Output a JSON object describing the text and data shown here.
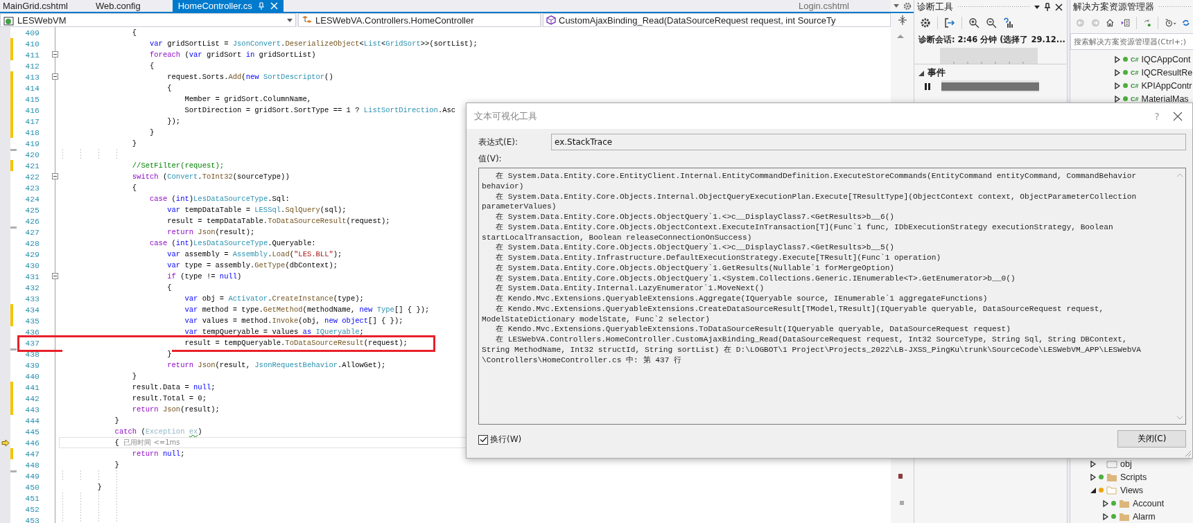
{
  "tabs": [
    {
      "label": "MainGrid.cshtml",
      "selected": false
    },
    {
      "label": "Web.config",
      "selected": false
    },
    {
      "label": "HomeController.cs",
      "selected": true
    },
    {
      "label": "Login.cshtml",
      "selected": false
    }
  ],
  "nav_bar": {
    "project": "LESWebVM",
    "class": "LESWebVA.Controllers.HomeController",
    "member": "CustomAjaxBinding_Read(DataSourceRequest request, int SourceTy"
  },
  "code_lines": [
    {
      "number": "409",
      "changed": false,
      "saved": false,
      "fold": false,
      "highlighted": false,
      "current": false,
      "tokens": [
        {
          "kind": "plain",
          "text": "                {"
        }
      ]
    },
    {
      "number": "410",
      "changed": true,
      "saved": false,
      "fold": false,
      "highlighted": false,
      "current": false,
      "tokens": [
        {
          "kind": "kw",
          "text": "                    var"
        },
        {
          "kind": "plain",
          "text": " gridSortList = "
        },
        {
          "kind": "type",
          "text": "JsonConvert"
        },
        {
          "kind": "plain",
          "text": "."
        },
        {
          "kind": "method",
          "text": "DeserializeObject"
        },
        {
          "kind": "plain",
          "text": "<"
        },
        {
          "kind": "type",
          "text": "List"
        },
        {
          "kind": "plain",
          "text": "<"
        },
        {
          "kind": "type",
          "text": "GridSort"
        },
        {
          "kind": "plain",
          "text": ">>(sortList);"
        }
      ]
    },
    {
      "number": "411",
      "changed": true,
      "saved": false,
      "fold": true,
      "highlighted": false,
      "current": false,
      "tokens": [
        {
          "kind": "ctrl",
          "text": "                    foreach"
        },
        {
          "kind": "plain",
          "text": " ("
        },
        {
          "kind": "kw",
          "text": "var"
        },
        {
          "kind": "plain",
          "text": " gridSort "
        },
        {
          "kind": "kw",
          "text": "in"
        },
        {
          "kind": "plain",
          "text": " gridSortList)"
        }
      ]
    },
    {
      "number": "412",
      "changed": false,
      "saved": false,
      "fold": false,
      "highlighted": false,
      "current": false,
      "tokens": [
        {
          "kind": "plain",
          "text": "                    {"
        }
      ]
    },
    {
      "number": "413",
      "changed": true,
      "saved": false,
      "fold": true,
      "highlighted": false,
      "current": false,
      "tokens": [
        {
          "kind": "plain",
          "text": "                        request.Sorts."
        },
        {
          "kind": "method",
          "text": "Add"
        },
        {
          "kind": "plain",
          "text": "("
        },
        {
          "kind": "kw",
          "text": "new "
        },
        {
          "kind": "type",
          "text": "SortDescriptor"
        },
        {
          "kind": "plain",
          "text": "()"
        }
      ]
    },
    {
      "number": "414",
      "changed": true,
      "saved": false,
      "fold": false,
      "highlighted": false,
      "current": false,
      "tokens": [
        {
          "kind": "plain",
          "text": "                        {"
        }
      ]
    },
    {
      "number": "415",
      "changed": true,
      "saved": false,
      "fold": false,
      "highlighted": false,
      "current": false,
      "tokens": [
        {
          "kind": "plain",
          "text": "                            Member = gridSort.ColumnName,"
        }
      ]
    },
    {
      "number": "416",
      "changed": true,
      "saved": false,
      "fold": false,
      "highlighted": false,
      "current": false,
      "tokens": [
        {
          "kind": "plain",
          "text": "                            SortDirection = gridSort.SortType == 1 ? "
        },
        {
          "kind": "type",
          "text": "ListSortDirection"
        },
        {
          "kind": "plain",
          "text": ".Asc"
        }
      ]
    },
    {
      "number": "417",
      "changed": true,
      "saved": false,
      "fold": false,
      "highlighted": false,
      "current": false,
      "tokens": [
        {
          "kind": "plain",
          "text": "                        });"
        }
      ]
    },
    {
      "number": "418",
      "changed": true,
      "saved": false,
      "fold": false,
      "highlighted": false,
      "current": false,
      "tokens": [
        {
          "kind": "plain",
          "text": "                    }"
        }
      ]
    },
    {
      "number": "419",
      "changed": false,
      "saved": false,
      "fold": false,
      "highlighted": false,
      "current": false,
      "tokens": [
        {
          "kind": "plain",
          "text": "                }"
        }
      ]
    },
    {
      "number": "420",
      "changed": false,
      "saved": true,
      "fold": false,
      "highlighted": false,
      "current": false
    },
    {
      "number": "421",
      "changed": true,
      "saved": false,
      "fold": false,
      "highlighted": false,
      "current": false,
      "tokens": [
        {
          "kind": "comment",
          "text": "                //SetFilter(request);"
        }
      ]
    },
    {
      "number": "422",
      "changed": false,
      "saved": false,
      "fold": true,
      "highlighted": false,
      "current": false,
      "tokens": [
        {
          "kind": "ctrl",
          "text": "                switch"
        },
        {
          "kind": "plain",
          "text": " ("
        },
        {
          "kind": "type",
          "text": "Convert"
        },
        {
          "kind": "plain",
          "text": "."
        },
        {
          "kind": "method",
          "text": "ToInt32"
        },
        {
          "kind": "plain",
          "text": "(sourceType))"
        }
      ]
    },
    {
      "number": "423",
      "changed": false,
      "saved": false,
      "fold": false,
      "highlighted": false,
      "current": false,
      "tokens": [
        {
          "kind": "plain",
          "text": "                {"
        }
      ]
    },
    {
      "number": "424",
      "changed": false,
      "saved": false,
      "fold": false,
      "highlighted": false,
      "current": false,
      "tokens": [
        {
          "kind": "ctrl",
          "text": "                    case"
        },
        {
          "kind": "plain",
          "text": " ("
        },
        {
          "kind": "kw",
          "text": "int"
        },
        {
          "kind": "plain",
          "text": ")"
        },
        {
          "kind": "type",
          "text": "LesDataSourceType"
        },
        {
          "kind": "plain",
          "text": ".Sql:"
        }
      ]
    },
    {
      "number": "425",
      "changed": false,
      "saved": false,
      "fold": false,
      "highlighted": false,
      "current": false,
      "tokens": [
        {
          "kind": "kw",
          "text": "                        var"
        },
        {
          "kind": "plain",
          "text": " tempDataTable = "
        },
        {
          "kind": "type",
          "text": "LESSql"
        },
        {
          "kind": "plain",
          "text": "."
        },
        {
          "kind": "method",
          "text": "SqlQuery"
        },
        {
          "kind": "plain",
          "text": "(sql);"
        }
      ]
    },
    {
      "number": "426",
      "changed": false,
      "saved": false,
      "fold": false,
      "highlighted": false,
      "current": false,
      "tokens": [
        {
          "kind": "plain",
          "text": "                        result = tempDataTable."
        },
        {
          "kind": "method",
          "text": "ToDataSourceResult"
        },
        {
          "kind": "plain",
          "text": "(request);"
        }
      ]
    },
    {
      "number": "427",
      "changed": false,
      "saved": true,
      "fold": false,
      "highlighted": false,
      "current": false,
      "tokens": [
        {
          "kind": "ctrl",
          "text": "                        return "
        },
        {
          "kind": "method",
          "text": "Json"
        },
        {
          "kind": "plain",
          "text": "(result);"
        }
      ]
    },
    {
      "number": "428",
      "changed": false,
      "saved": false,
      "fold": false,
      "highlighted": false,
      "current": false,
      "tokens": [
        {
          "kind": "ctrl",
          "text": "                    case"
        },
        {
          "kind": "plain",
          "text": " ("
        },
        {
          "kind": "kw",
          "text": "int"
        },
        {
          "kind": "plain",
          "text": ")"
        },
        {
          "kind": "type",
          "text": "LesDataSourceType"
        },
        {
          "kind": "plain",
          "text": ".Queryable:"
        }
      ]
    },
    {
      "number": "429",
      "changed": false,
      "saved": false,
      "fold": false,
      "highlighted": false,
      "current": false,
      "tokens": [
        {
          "kind": "kw",
          "text": "                        var"
        },
        {
          "kind": "plain",
          "text": " assembly = "
        },
        {
          "kind": "type",
          "text": "Assembly"
        },
        {
          "kind": "plain",
          "text": "."
        },
        {
          "kind": "method",
          "text": "Load"
        },
        {
          "kind": "plain",
          "text": "("
        },
        {
          "kind": "str",
          "text": "\"LES.BLL\""
        },
        {
          "kind": "plain",
          "text": ");"
        }
      ]
    },
    {
      "number": "430",
      "changed": false,
      "saved": false,
      "fold": false,
      "highlighted": false,
      "current": false,
      "tokens": [
        {
          "kind": "kw",
          "text": "                        var"
        },
        {
          "kind": "plain",
          "text": " type = assembly."
        },
        {
          "kind": "method",
          "text": "GetType"
        },
        {
          "kind": "plain",
          "text": "(dbContext);"
        }
      ]
    },
    {
      "number": "431",
      "changed": false,
      "saved": false,
      "fold": true,
      "highlighted": false,
      "current": false,
      "tokens": [
        {
          "kind": "ctrl",
          "text": "                        if"
        },
        {
          "kind": "plain",
          "text": " (type != "
        },
        {
          "kind": "kw",
          "text": "null"
        },
        {
          "kind": "plain",
          "text": ")"
        }
      ]
    },
    {
      "number": "432",
      "changed": false,
      "saved": false,
      "fold": false,
      "highlighted": false,
      "current": false,
      "tokens": [
        {
          "kind": "plain",
          "text": "                        {"
        }
      ]
    },
    {
      "number": "433",
      "changed": false,
      "saved": false,
      "fold": false,
      "highlighted": false,
      "current": false,
      "tokens": [
        {
          "kind": "kw",
          "text": "                            var"
        },
        {
          "kind": "plain",
          "text": " obj = "
        },
        {
          "kind": "type",
          "text": "Activator"
        },
        {
          "kind": "plain",
          "text": "."
        },
        {
          "kind": "method",
          "text": "CreateInstance"
        },
        {
          "kind": "plain",
          "text": "(type);"
        }
      ]
    },
    {
      "number": "434",
      "changed": true,
      "saved": false,
      "fold": false,
      "highlighted": false,
      "current": false,
      "tokens": [
        {
          "kind": "kw",
          "text": "                            var"
        },
        {
          "kind": "plain",
          "text": " method = type."
        },
        {
          "kind": "method",
          "text": "GetMethod"
        },
        {
          "kind": "plain",
          "text": "(methodName, "
        },
        {
          "kind": "kw",
          "text": "new "
        },
        {
          "kind": "type",
          "text": "Type"
        },
        {
          "kind": "plain",
          "text": "[] { });"
        }
      ]
    },
    {
      "number": "435",
      "changed": true,
      "saved": false,
      "fold": false,
      "highlighted": false,
      "current": false,
      "tokens": [
        {
          "kind": "kw",
          "text": "                            var"
        },
        {
          "kind": "plain",
          "text": " values = method."
        },
        {
          "kind": "method",
          "text": "Invoke"
        },
        {
          "kind": "plain",
          "text": "(obj, "
        },
        {
          "kind": "kw",
          "text": "new object"
        },
        {
          "kind": "plain",
          "text": "[] { });"
        }
      ]
    },
    {
      "number": "436",
      "changed": false,
      "saved": false,
      "fold": false,
      "highlighted": false,
      "current": false,
      "tokens": [
        {
          "kind": "kw",
          "text": "                            var"
        },
        {
          "kind": "plain",
          "text": " tempQueryable = values "
        },
        {
          "kind": "kw",
          "text": "as "
        },
        {
          "kind": "type",
          "text": "IQueryable"
        },
        {
          "kind": "plain",
          "text": ";"
        }
      ]
    },
    {
      "number": "437",
      "changed": false,
      "saved": false,
      "fold": false,
      "highlighted": true,
      "current": false,
      "tokens": [
        {
          "kind": "plain",
          "text": "                            result = tempQueryable."
        },
        {
          "kind": "method",
          "text": "ToDataSourceResult"
        },
        {
          "kind": "plain",
          "text": "(request);"
        }
      ]
    },
    {
      "number": "438",
      "changed": false,
      "saved": true,
      "fold": false,
      "highlighted": false,
      "current": false,
      "tokens": [
        {
          "kind": "plain",
          "text": "                        }"
        }
      ]
    },
    {
      "number": "439",
      "changed": false,
      "saved": false,
      "fold": false,
      "highlighted": false,
      "current": false,
      "tokens": [
        {
          "kind": "ctrl",
          "text": "                        return "
        },
        {
          "kind": "method",
          "text": "Json"
        },
        {
          "kind": "plain",
          "text": "(result, "
        },
        {
          "kind": "type",
          "text": "JsonRequestBehavior"
        },
        {
          "kind": "plain",
          "text": ".AllowGet);"
        }
      ]
    },
    {
      "number": "440",
      "changed": false,
      "saved": false,
      "fold": false,
      "highlighted": false,
      "current": false,
      "tokens": [
        {
          "kind": "plain",
          "text": "                }"
        }
      ]
    },
    {
      "number": "441",
      "changed": true,
      "saved": false,
      "fold": false,
      "highlighted": false,
      "current": false,
      "tokens": [
        {
          "kind": "plain",
          "text": "                result.Data = "
        },
        {
          "kind": "kw",
          "text": "null"
        },
        {
          "kind": "plain",
          "text": ";"
        }
      ]
    },
    {
      "number": "442",
      "changed": true,
      "saved": false,
      "fold": false,
      "highlighted": false,
      "current": false,
      "tokens": [
        {
          "kind": "plain",
          "text": "                result.Total = 0;"
        }
      ]
    },
    {
      "number": "443",
      "changed": true,
      "saved": false,
      "fold": false,
      "highlighted": false,
      "current": false,
      "tokens": [
        {
          "kind": "ctrl",
          "text": "                return "
        },
        {
          "kind": "method",
          "text": "Json"
        },
        {
          "kind": "plain",
          "text": "(result);"
        }
      ]
    },
    {
      "number": "444",
      "changed": false,
      "saved": false,
      "fold": false,
      "highlighted": false,
      "current": false,
      "tokens": [
        {
          "kind": "plain",
          "text": "            }"
        }
      ]
    },
    {
      "number": "445",
      "changed": false,
      "saved": false,
      "fold": false,
      "highlighted": false,
      "current": false,
      "tokens": [
        {
          "kind": "ctrl",
          "text": "            catch"
        },
        {
          "kind": "plain",
          "text": " ("
        },
        {
          "kind": "dim",
          "text": "Exception "
        },
        {
          "kind": "warn",
          "text": "ex"
        },
        {
          "kind": "plain",
          "text": ")"
        }
      ]
    },
    {
      "number": "446",
      "changed": false,
      "saved": false,
      "fold": false,
      "highlighted": false,
      "current": true,
      "tokens": [
        {
          "kind": "plain",
          "text": "            { "
        },
        {
          "kind": "hint",
          "text": "已用时间 <=1ms"
        }
      ]
    },
    {
      "number": "447",
      "changed": true,
      "saved": false,
      "fold": false,
      "highlighted": false,
      "current": false,
      "tokens": [
        {
          "kind": "ctrl",
          "text": "                return "
        },
        {
          "kind": "kw",
          "text": "null"
        },
        {
          "kind": "plain",
          "text": ";"
        }
      ]
    },
    {
      "number": "448",
      "changed": false,
      "saved": false,
      "fold": false,
      "highlighted": false,
      "current": false,
      "tokens": [
        {
          "kind": "plain",
          "text": "            }"
        }
      ]
    },
    {
      "number": "449",
      "changed": false,
      "saved": true,
      "fold": false,
      "highlighted": false,
      "current": false
    },
    {
      "number": "450",
      "changed": false,
      "saved": false,
      "fold": false,
      "highlighted": false,
      "current": false,
      "tokens": [
        {
          "kind": "plain",
          "text": "        }"
        }
      ]
    },
    {
      "number": "451",
      "changed": false,
      "saved": false,
      "fold": false,
      "highlighted": false,
      "current": false
    },
    {
      "number": "452",
      "changed": false,
      "saved": false,
      "fold": false,
      "highlighted": false,
      "current": false
    },
    {
      "number": "453",
      "changed": false,
      "saved": false,
      "fold": false,
      "highlighted": false,
      "current": false
    }
  ],
  "diagnostics_panel": {
    "title": "诊断工具",
    "session": "诊断会话: 2:46 分钟 (选择了 29.12...",
    "events_label": "事件",
    "events_expanded": true
  },
  "solution_explorer": {
    "title": "解决方案资源管理器",
    "search": {
      "placeholder": "搜索解决方案资源管理器(Ctrl+;)"
    },
    "tree_top": [
      {
        "label": "IQCAppCont",
        "kind": "csharp",
        "badge": "C#",
        "expanded": false,
        "color": "#4caf3c"
      },
      {
        "label": "IQCResultRe",
        "kind": "csharp",
        "badge": "C#",
        "expanded": false,
        "color": "#4caf3c"
      },
      {
        "label": "KPIAppContr",
        "kind": "csharp",
        "badge": "C#",
        "expanded": false,
        "color": "#4caf3c"
      },
      {
        "label": "MaterialMas",
        "kind": "csharp",
        "badge": "C#",
        "expanded": false,
        "color": "#4caf3c"
      }
    ],
    "tree_bottom": [
      {
        "label": "obj",
        "kind": "excluded",
        "expanded": false
      },
      {
        "label": "Scripts",
        "kind": "folder",
        "expanded": false,
        "color": "#4caf3c"
      },
      {
        "label": "Views",
        "kind": "folder",
        "expanded": true,
        "color": "#f0a30a",
        "children": [
          {
            "label": "Account",
            "kind": "folder",
            "expanded": false,
            "color": "#4caf3c"
          },
          {
            "label": "Alarm",
            "kind": "folder",
            "expanded": false,
            "color": "#4caf3c"
          }
        ]
      }
    ]
  },
  "dialog": {
    "title": "文本可视化工具",
    "help": "?",
    "expression": {
      "label": "表达式(E):",
      "value": "ex.StackTrace"
    },
    "value_label": "值(V):",
    "value_lines": [
      "   在 System.Data.Entity.Core.EntityClient.Internal.EntityCommandDefinition.ExecuteStoreCommands(EntityCommand entityCommand, CommandBehavior",
      "behavior)",
      "   在 System.Data.Entity.Core.Objects.Internal.ObjectQueryExecutionPlan.Execute[TResultType](ObjectContext context, ObjectParameterCollection",
      "parameterValues)",
      "   在 System.Data.Entity.Core.Objects.ObjectQuery`1.<>c__DisplayClass7.<GetResults>b__6()",
      "   在 System.Data.Entity.Core.Objects.ObjectContext.ExecuteInTransaction[T](Func`1 func, IDbExecutionStrategy executionStrategy, Boolean",
      "startLocalTransaction, Boolean releaseConnectionOnSuccess)",
      "   在 System.Data.Entity.Core.Objects.ObjectQuery`1.<>c__DisplayClass7.<GetResults>b__5()",
      "   在 System.Data.Entity.Infrastructure.DefaultExecutionStrategy.Execute[TResult](Func`1 operation)",
      "   在 System.Data.Entity.Core.Objects.ObjectQuery`1.GetResults(Nullable`1 forMergeOption)",
      "   在 System.Data.Entity.Core.Objects.ObjectQuery`1.<System.Collections.Generic.IEnumerable<T>.GetEnumerator>b__0()",
      "   在 System.Data.Entity.Internal.LazyEnumerator`1.MoveNext()",
      "   在 Kendo.Mvc.Extensions.QueryableExtensions.Aggregate(IQueryable source, IEnumerable`1 aggregateFunctions)",
      "   在 Kendo.Mvc.Extensions.QueryableExtensions.CreateDataSourceResult[TModel,TResult](IQueryable queryable, DataSourceRequest request,",
      "ModelStateDictionary modelState, Func`2 selector)",
      "   在 Kendo.Mvc.Extensions.QueryableExtensions.ToDataSourceResult(IQueryable queryable, DataSourceRequest request)",
      "   在 LESWebVA.Controllers.HomeController.CustomAjaxBinding_Read(DataSourceRequest request, Int32 SourceType, String Sql, String DBContext,",
      "String MethodName, Int32 structId, String sortList) 在 D:\\LOGBOT\\1 Project\\Projects_2022\\LB-JXSS_PingKu\\trunk\\SourceCode\\LESWebVM_APP\\LESWebVA",
      "\\Controllers\\HomeController.cs 中: 第 437 行"
    ],
    "wrap": {
      "label": "换行(W)",
      "checked": true
    },
    "close_button": "关闭(C)"
  }
}
